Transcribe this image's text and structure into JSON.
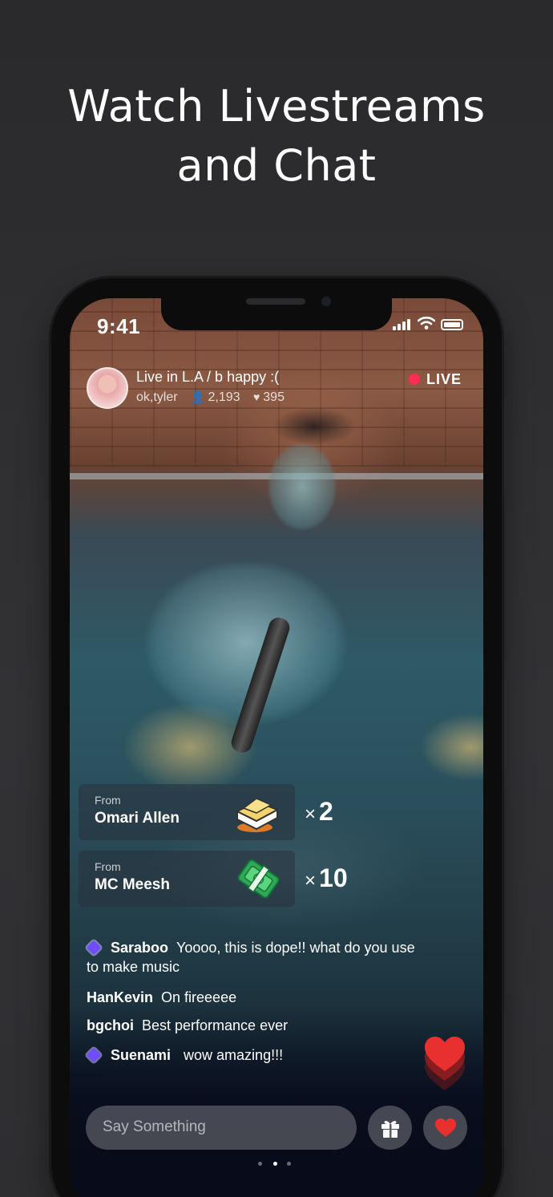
{
  "headline": {
    "line1": "Watch Livestreams",
    "line2": "and Chat"
  },
  "status_bar": {
    "time": "9:41",
    "icons": [
      "signal-icon",
      "wifi-icon",
      "battery-icon"
    ]
  },
  "stream": {
    "title": "Live in L.A / b happy :(",
    "host": "ok,tyler",
    "viewers": "2,193",
    "likes": "395",
    "live_label": "LIVE",
    "live_color": "#ff2d55"
  },
  "gifts": [
    {
      "from_label": "From",
      "name": "Omari Allen",
      "icon": "noodle-box-icon",
      "multiplier": "×",
      "count": "2"
    },
    {
      "from_label": "From",
      "name": "MC Meesh",
      "icon": "money-stack-icon",
      "multiplier": "×",
      "count": "10"
    }
  ],
  "chat": [
    {
      "badge": true,
      "user": "Saraboo",
      "message": "Yoooo, this is dope!! what do you use to make music"
    },
    {
      "badge": false,
      "user": "HanKevin",
      "message": "On fireeeee"
    },
    {
      "badge": false,
      "user": "bgchoi",
      "message": "Best performance ever"
    },
    {
      "badge": true,
      "user": "Suenami",
      "message": "wow amazing!!!"
    }
  ],
  "composer": {
    "placeholder": "Say Something"
  },
  "actions": {
    "gift_icon": "gift-icon",
    "heart_icon": "heart-icon",
    "heart_color": "#e8302f"
  },
  "pager": {
    "count": 3,
    "active": 2
  }
}
